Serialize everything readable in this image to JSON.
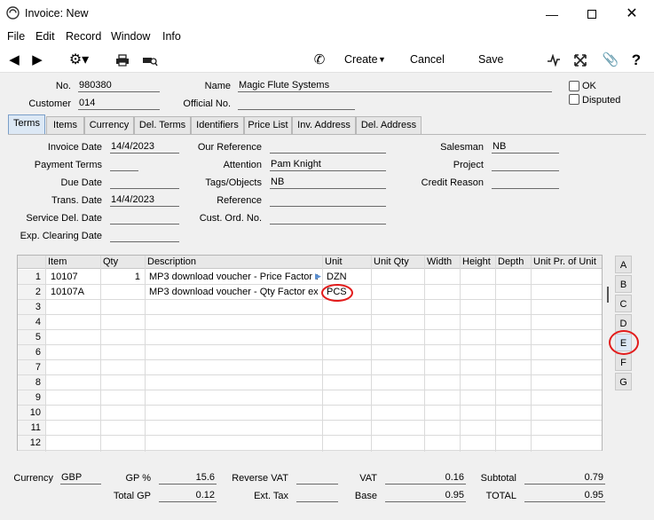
{
  "window": {
    "title": "Invoice: New"
  },
  "menu": [
    "File",
    "Edit",
    "Record",
    "Window",
    "Info"
  ],
  "toolbar": {
    "create": "Create",
    "cancel": "Cancel",
    "save": "Save"
  },
  "header": {
    "no_label": "No.",
    "no_value": "980380",
    "name_label": "Name",
    "name_value": "Magic Flute Systems",
    "customer_label": "Customer",
    "customer_value": "014",
    "official_label": "Official No.",
    "official_value": "",
    "ok_label": "OK",
    "disputed_label": "Disputed"
  },
  "tabs": [
    "Terms",
    "Items",
    "Currency",
    "Del. Terms",
    "Identifiers",
    "Price List",
    "Inv. Address",
    "Del. Address"
  ],
  "terms": {
    "invoice_date_label": "Invoice Date",
    "invoice_date": "14/4/2023",
    "payment_terms_label": "Payment Terms",
    "payment_terms": "",
    "due_date_label": "Due Date",
    "due_date": "",
    "trans_date_label": "Trans. Date",
    "trans_date": "14/4/2023",
    "service_del_label": "Service Del. Date",
    "service_del": "",
    "exp_clearing_label": "Exp. Clearing Date",
    "exp_clearing": "",
    "our_ref_label": "Our Reference",
    "our_ref": "",
    "attention_label": "Attention",
    "attention": "Pam Knight",
    "tags_label": "Tags/Objects",
    "tags": "NB",
    "reference_label": "Reference",
    "reference": "",
    "cust_ord_label": "Cust. Ord. No.",
    "cust_ord": "",
    "salesman_label": "Salesman",
    "salesman": "NB",
    "project_label": "Project",
    "project": "",
    "credit_reason_label": "Credit Reason",
    "credit_reason": ""
  },
  "grid": {
    "columns": [
      "Item",
      "Qty",
      "Description",
      "Unit",
      "Unit Qty",
      "Width",
      "Height",
      "Depth",
      "Unit Pr. of Unit"
    ],
    "rows": [
      {
        "n": "1",
        "item": "10107",
        "qty": "1",
        "desc": "MP3 download voucher - Price Factor e",
        "unit": "DZN"
      },
      {
        "n": "2",
        "item": "10107A",
        "qty": "",
        "desc": "MP3 download voucher - Qty Factor ex",
        "unit": "PCS"
      },
      {
        "n": "3"
      },
      {
        "n": "4"
      },
      {
        "n": "5"
      },
      {
        "n": "6"
      },
      {
        "n": "7"
      },
      {
        "n": "8"
      },
      {
        "n": "9"
      },
      {
        "n": "10"
      },
      {
        "n": "11"
      },
      {
        "n": "12"
      }
    ],
    "side_tabs": [
      "A",
      "B",
      "C",
      "D",
      "E",
      "F",
      "G"
    ],
    "selected_side_tab": "E"
  },
  "footer": {
    "currency_label": "Currency",
    "currency": "GBP",
    "gp_pct_label": "GP %",
    "gp_pct": "15.6",
    "total_gp_label": "Total GP",
    "total_gp": "0.12",
    "reverse_vat_label": "Reverse VAT",
    "reverse_vat": "",
    "ext_tax_label": "Ext. Tax",
    "ext_tax": "",
    "vat_label": "VAT",
    "vat": "0.16",
    "base_label": "Base",
    "base": "0.95",
    "subtotal_label": "Subtotal",
    "subtotal": "0.79",
    "total_label": "TOTAL",
    "total": "0.95"
  },
  "colors": {
    "highlight_circle": "#e21b1b",
    "selected_tab": "#dce8f5"
  }
}
